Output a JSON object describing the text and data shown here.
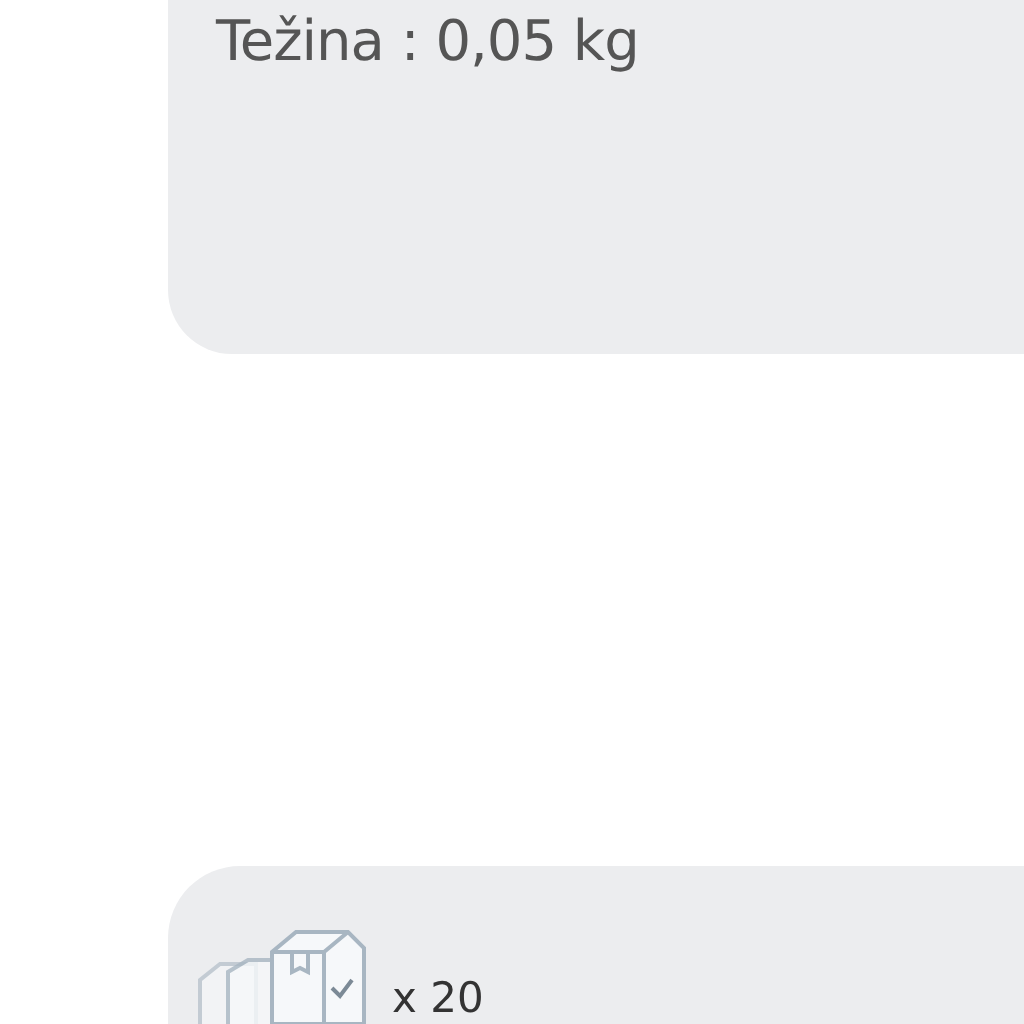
{
  "product_card": {
    "weight": "Težina : 0,05 kg"
  },
  "package_card": {
    "quantity": "x 20"
  }
}
